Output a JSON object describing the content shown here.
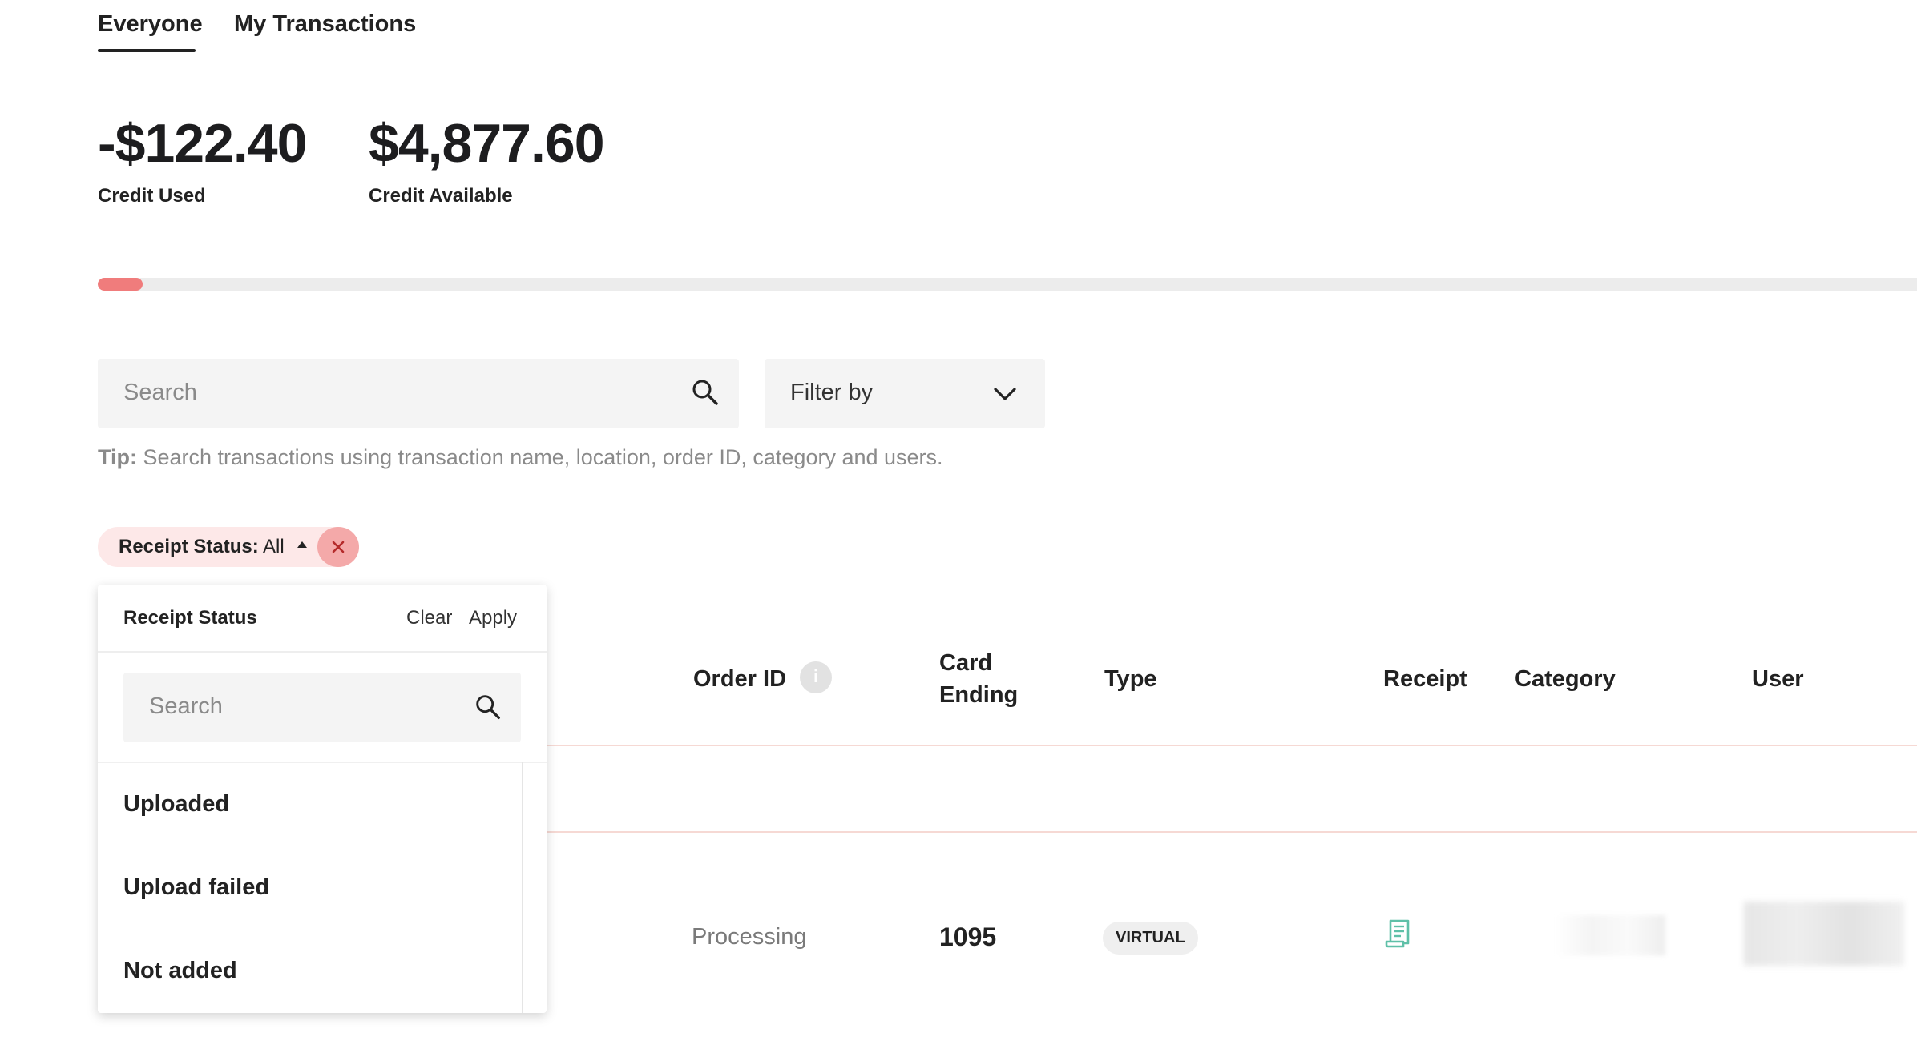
{
  "tabs": [
    {
      "label": "Everyone",
      "active": true
    },
    {
      "label": "My Transactions",
      "active": false
    }
  ],
  "stats": {
    "credit_used_value": "-$122.40",
    "credit_used_label": "Credit Used",
    "credit_available_value": "$4,877.60",
    "credit_available_label": "Credit Available"
  },
  "progress": {
    "fraction_used": 0.0245,
    "color": "#f07c7c"
  },
  "search": {
    "placeholder": "Search",
    "icon": "search-icon"
  },
  "filter": {
    "label": "Filter by",
    "icon": "chevron-down-icon"
  },
  "tip": {
    "prefix": "Tip:",
    "text": " Search transactions using transaction name, location, order ID, category and users."
  },
  "chip": {
    "key": "Receipt Status:",
    "value": " All",
    "icon": "close-icon"
  },
  "dropdown": {
    "title": "Receipt Status",
    "clear_label": "Clear",
    "apply_label": "Apply",
    "search_placeholder": "Search",
    "options": [
      "Uploaded",
      "Upload failed",
      "Not added"
    ]
  },
  "table": {
    "headers": {
      "order_id": "Order ID",
      "card_ending_line1": "Card",
      "card_ending_line2": "Ending",
      "type": "Type",
      "receipt": "Receipt",
      "category": "Category",
      "user": "User"
    },
    "rows": [
      {
        "order_id": "Processing",
        "card_ending": "1095",
        "type": "VIRTUAL",
        "receipt_icon": "receipt-icon"
      }
    ]
  },
  "colors": {
    "accent": "#f07c7c",
    "chip_bg": "#fde8e8",
    "receipt_icon": "#5fc0a8"
  }
}
